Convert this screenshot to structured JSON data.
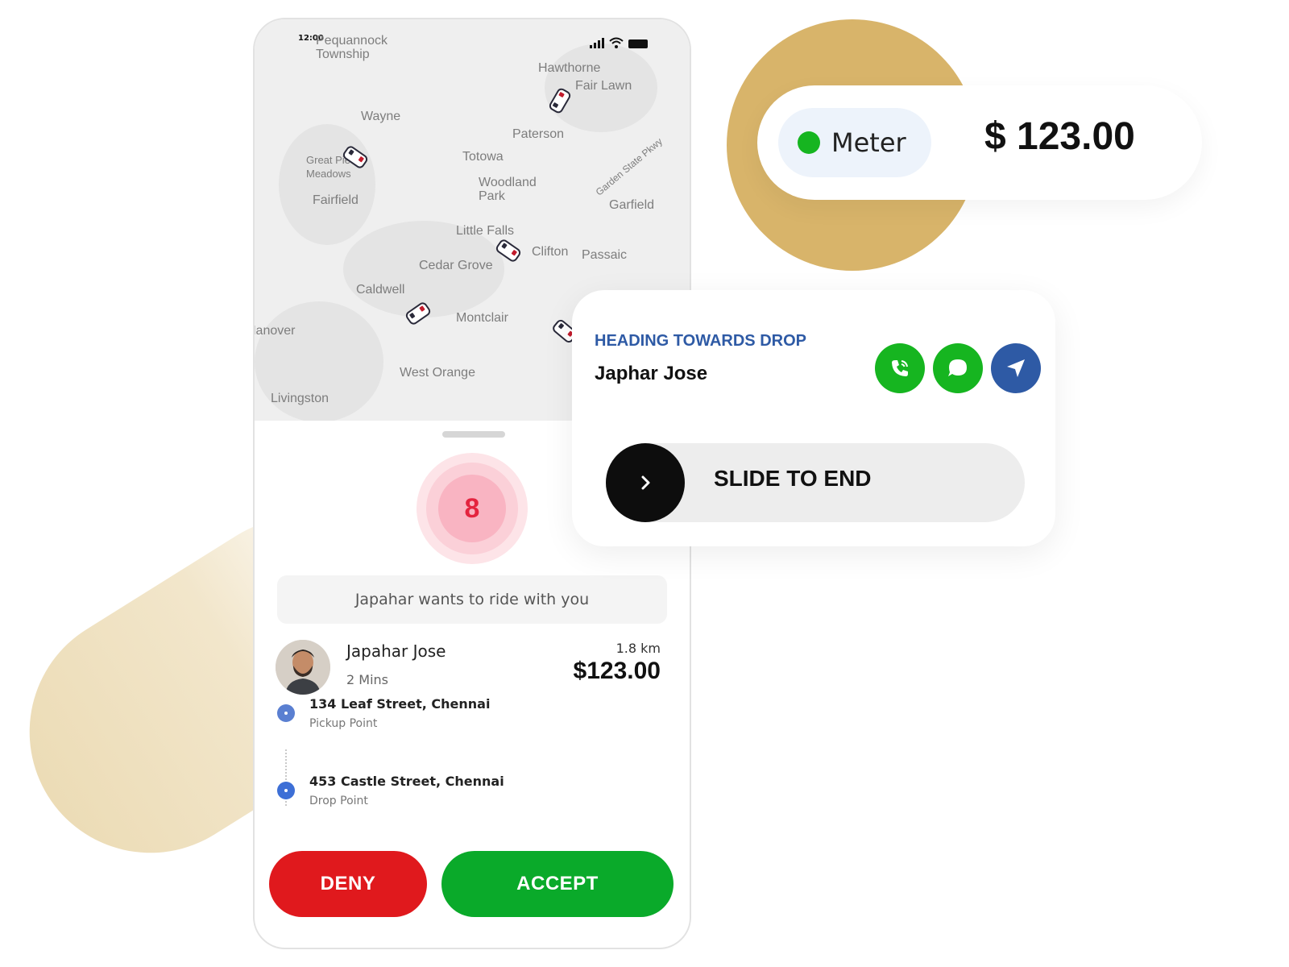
{
  "status_bar": {
    "time": "12:00"
  },
  "map": {
    "labels": [
      "Pequannock\nTownship",
      "Hawthorne",
      "Fair Lawn",
      "Wayne",
      "Paterson",
      "Totowa",
      "Great Piece\nMeadows",
      "Woodland\nPark",
      "Garfield",
      "Fairfield",
      "Little Falls",
      "Clifton",
      "Passaic",
      "Cedar Grove",
      "Caldwell",
      "Montclair",
      "West Orange",
      "Livingston",
      "Hanover",
      "Garden State Pkwy"
    ]
  },
  "request": {
    "timer": "8",
    "banner": "Japahar wants to ride with you",
    "rider_name": "Japahar Jose",
    "eta": "2 Mins",
    "distance": "1.8 km",
    "fare": "$123.00",
    "pickup_address": "134 Leaf Street, Chennai",
    "pickup_label": "Pickup Point",
    "drop_address": "453 Castle Street, Chennai",
    "drop_label": "Drop Point",
    "deny_label": "DENY",
    "accept_label": "ACCEPT"
  },
  "meter": {
    "label": "Meter",
    "amount": "$ 123.00",
    "status_color": "#16b520"
  },
  "trip": {
    "status": "HEADING TOWARDS DROP",
    "passenger": "Japhar Jose",
    "actions": [
      "phone-icon",
      "chat-icon",
      "navigate-icon"
    ],
    "slide_label": "SLIDE TO END"
  },
  "colors": {
    "deny": "#e0191d",
    "accept": "#0aaa2a",
    "accent_gold": "#d8b46a",
    "heading_blue": "#2e5aa5"
  }
}
